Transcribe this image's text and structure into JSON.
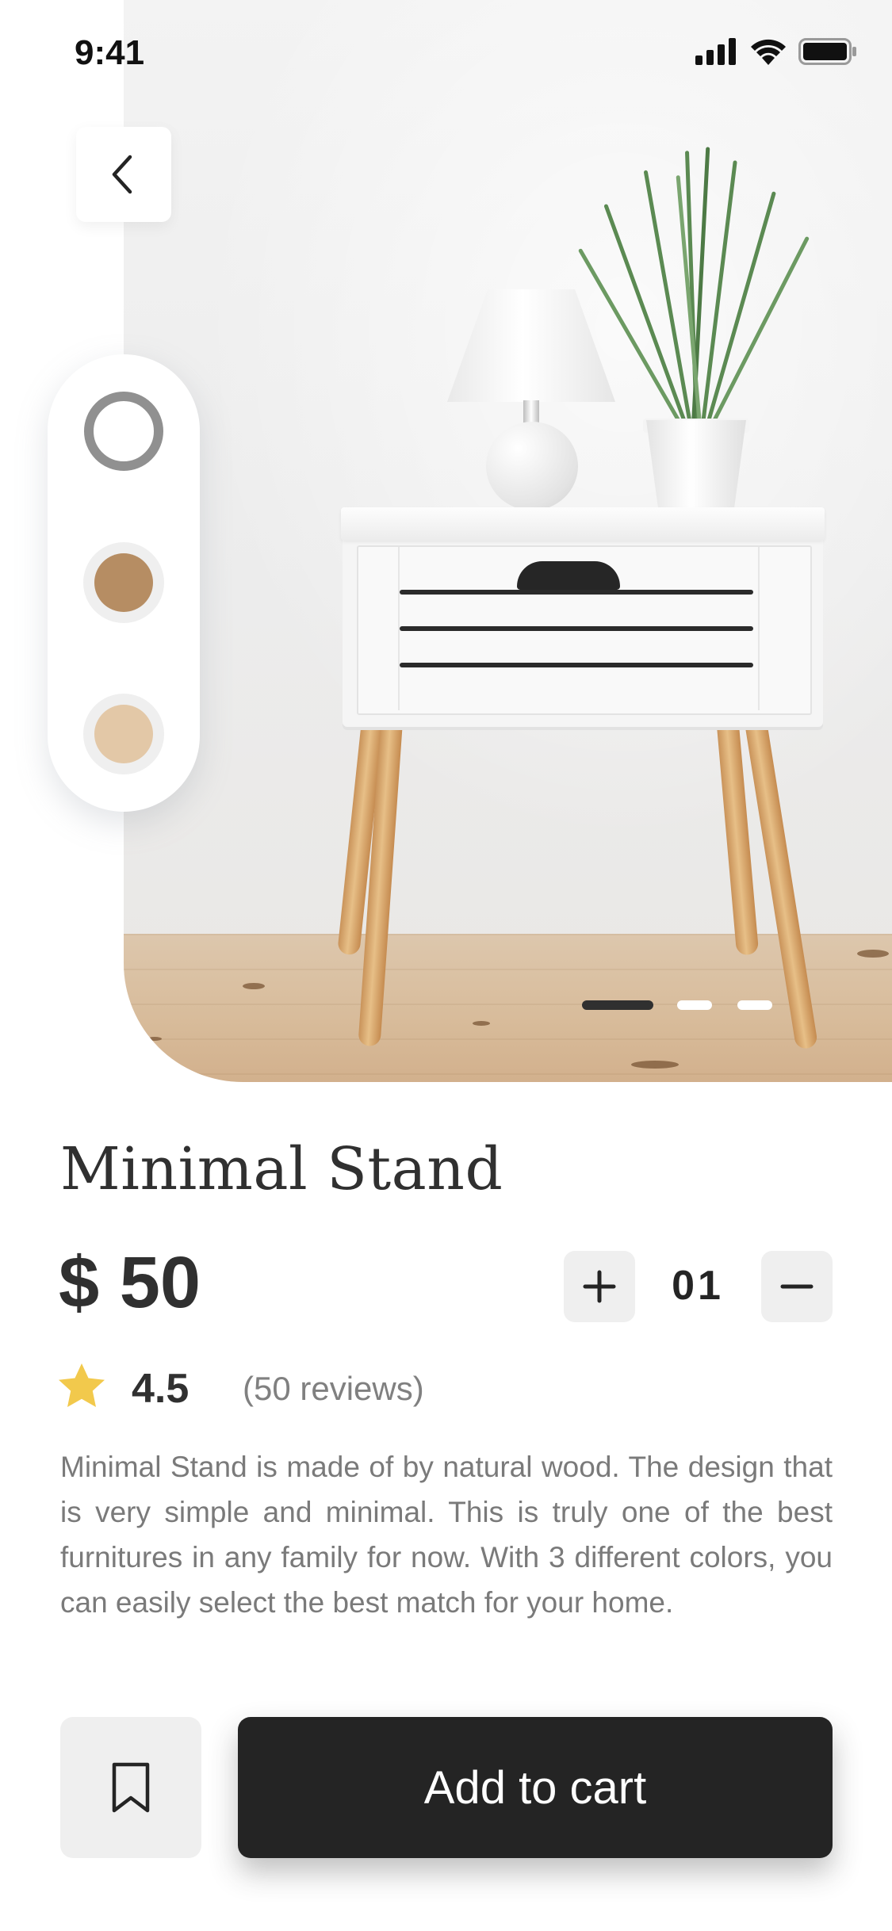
{
  "status_bar": {
    "time": "9:41",
    "icons": [
      "cellular-signal-icon",
      "wifi-icon",
      "battery-icon"
    ]
  },
  "navigation": {
    "back_icon": "chevron-left-icon"
  },
  "color_options": [
    {
      "name": "white",
      "hex": "#FFFFFF",
      "selected": true
    },
    {
      "name": "wood-brown",
      "hex": "#B68D63",
      "selected": false
    },
    {
      "name": "light-wood",
      "hex": "#E3C8A7",
      "selected": false
    }
  ],
  "image_carousel": {
    "total": 3,
    "active_index": 0
  },
  "product": {
    "title": "Minimal Stand",
    "price": "$ 50",
    "quantity": "01",
    "rating": "4.5",
    "reviews": "(50 reviews)",
    "description": "Minimal Stand is made of by natural wood. The design that is very simple and minimal. This is truly one of the best furnitures in any family for now. With 3 different colors, you can easily select the best match for your home."
  },
  "actions": {
    "add_to_cart_label": "Add to cart",
    "bookmark_icon": "bookmark-icon",
    "increase_icon": "plus-icon",
    "decrease_icon": "minus-icon"
  },
  "colors": {
    "primary_dark": "#242424",
    "text_primary": "#303030",
    "text_secondary": "#808080",
    "star": "#F2C94C",
    "button_light": "#EFEFEF"
  }
}
